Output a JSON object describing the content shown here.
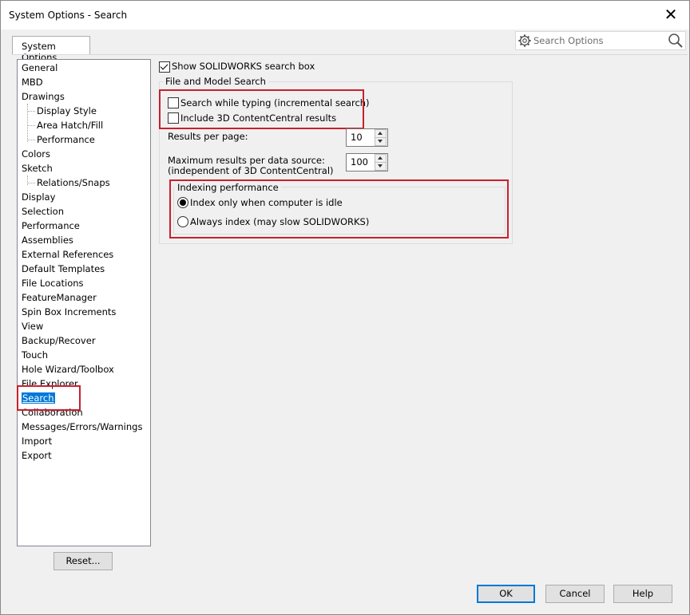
{
  "window": {
    "title": "System Options - Search",
    "close_glyph": "✕"
  },
  "tabs": {
    "system_options": "System Options"
  },
  "search": {
    "placeholder": "Search Options"
  },
  "tree": {
    "items": [
      {
        "label": "General",
        "level": 0
      },
      {
        "label": "MBD",
        "level": 0
      },
      {
        "label": "Drawings",
        "level": 0
      },
      {
        "label": "Display Style",
        "level": 1
      },
      {
        "label": "Area Hatch/Fill",
        "level": 1
      },
      {
        "label": "Performance",
        "level": 1
      },
      {
        "label": "Colors",
        "level": 0
      },
      {
        "label": "Sketch",
        "level": 0
      },
      {
        "label": "Relations/Snaps",
        "level": 1
      },
      {
        "label": "Display",
        "level": 0
      },
      {
        "label": "Selection",
        "level": 0
      },
      {
        "label": "Performance",
        "level": 0
      },
      {
        "label": "Assemblies",
        "level": 0
      },
      {
        "label": "External References",
        "level": 0
      },
      {
        "label": "Default Templates",
        "level": 0
      },
      {
        "label": "File Locations",
        "level": 0
      },
      {
        "label": "FeatureManager",
        "level": 0
      },
      {
        "label": "Spin Box Increments",
        "level": 0
      },
      {
        "label": "View",
        "level": 0
      },
      {
        "label": "Backup/Recover",
        "level": 0
      },
      {
        "label": "Touch",
        "level": 0
      },
      {
        "label": "Hole Wizard/Toolbox",
        "level": 0
      },
      {
        "label": "File Explorer",
        "level": 0
      },
      {
        "label": "Search",
        "level": 0,
        "selected": true
      },
      {
        "label": "Collaboration",
        "level": 0
      },
      {
        "label": "Messages/Errors/Warnings",
        "level": 0
      },
      {
        "label": "Import",
        "level": 0
      },
      {
        "label": "Export",
        "level": 0
      }
    ],
    "reset_label": "Reset..."
  },
  "options": {
    "show_search_box": {
      "label": "Show SOLIDWORKS search box",
      "checked": true
    },
    "file_model_group": "File and Model Search",
    "search_while_typing": {
      "label": "Search while typing (incremental search)",
      "checked": false
    },
    "include_3d_content": {
      "label": "Include 3D ContentCentral results",
      "checked": false
    },
    "results_per_page": {
      "label": "Results per page:",
      "value": "10"
    },
    "max_results": {
      "label_line1": "Maximum results per data source:",
      "label_line2": "(independent of 3D ContentCentral)",
      "value": "100"
    },
    "indexing_group": "Indexing performance",
    "index_idle": {
      "label": "Index only when computer is idle",
      "selected": true
    },
    "always_index": {
      "label": "Always index (may slow SOLIDWORKS)",
      "selected": false
    }
  },
  "footer": {
    "ok": "OK",
    "cancel": "Cancel",
    "help": "Help"
  },
  "colors": {
    "accent": "#0078d7",
    "highlight_box": "#c8202e"
  }
}
